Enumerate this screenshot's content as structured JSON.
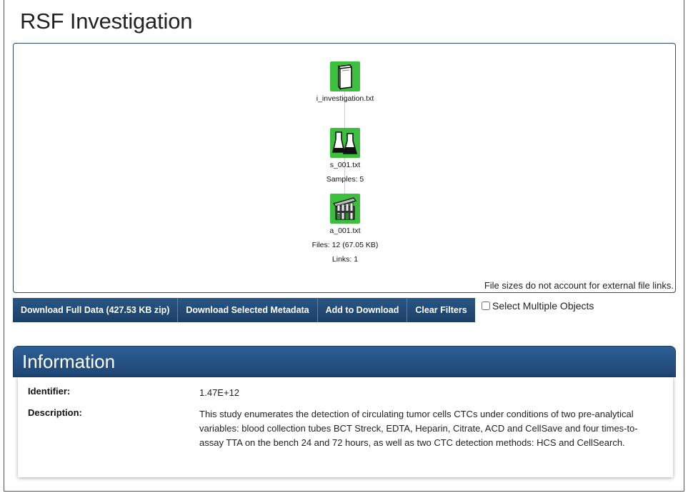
{
  "page": {
    "title": "RSF Investigation"
  },
  "graph": {
    "nodes": [
      {
        "icon": "book-icon",
        "label": "i_investigation.txt",
        "sub": []
      },
      {
        "icon": "flasks-icon",
        "label": "s_001.txt",
        "sub": [
          "Samples: 5"
        ]
      },
      {
        "icon": "test-tubes-icon",
        "label": "a_001.txt",
        "sub": [
          "Files: 12 (67.05 KB)",
          "Links: 1"
        ]
      }
    ],
    "footnote": "File sizes do not account for external file links."
  },
  "toolbar": {
    "download_full": "Download Full Data (427.53 KB zip)",
    "download_metadata": "Download Selected Metadata",
    "add_to_download": "Add to Download",
    "clear_filters": "Clear Filters",
    "select_multiple": "Select Multiple Objects"
  },
  "information": {
    "title": "Information",
    "identifier_label": "Identifier:",
    "identifier_value": "1.47E+12",
    "description_label": "Description:",
    "description_value": "This study enumerates the detection of circulating tumor cells CTCs under conditions of two pre-analytical variables: blood collection tubes BCT Streck, EDTA, Heparin, Citrate, ACD and CellSave and four times-to-assay TTA on the bench 24 and 72 hours, as well as two CTC detection methods: HCS and CellSearch."
  },
  "colors": {
    "node_green": "#3cbf3c",
    "toolbar_blue": "#1c3f66",
    "header_blue": "#2e5f95"
  }
}
